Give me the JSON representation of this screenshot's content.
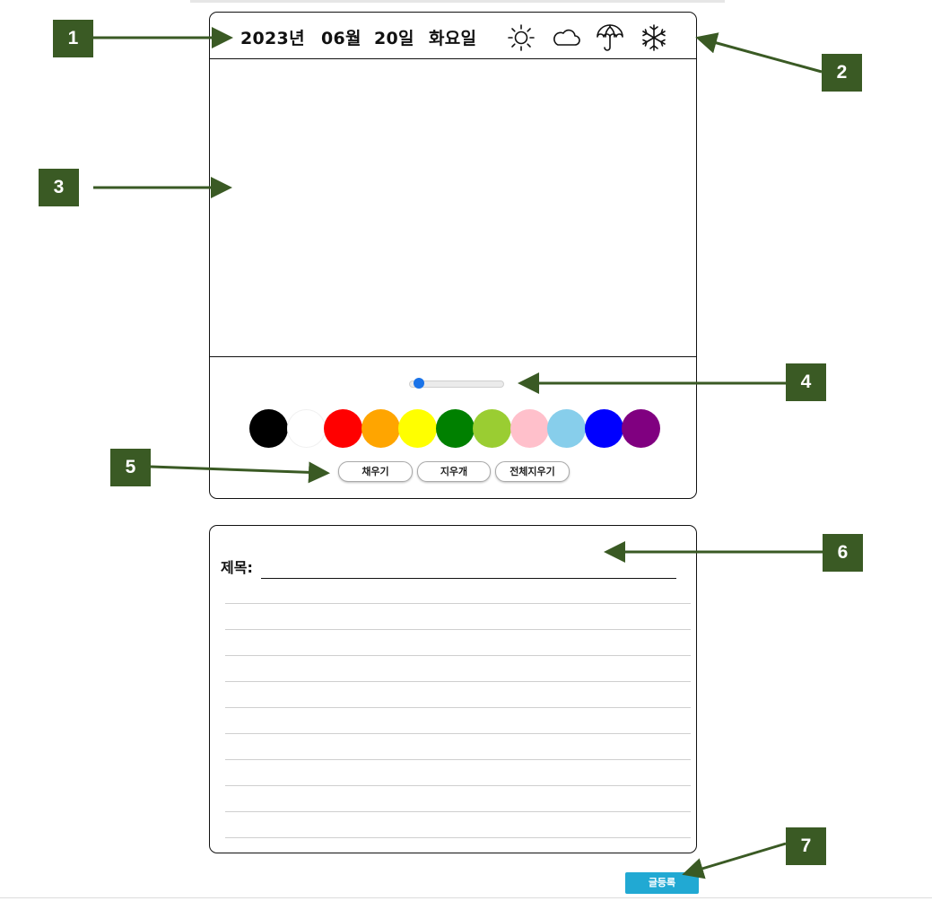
{
  "header": {
    "year": "2023년",
    "month": "06월",
    "day": "20일",
    "weekday": "화요일"
  },
  "weather": [
    {
      "name": "sunny",
      "icon": "sun-icon"
    },
    {
      "name": "cloudy",
      "icon": "cloud-icon"
    },
    {
      "name": "rainy",
      "icon": "umbrella-icon"
    },
    {
      "name": "snowy",
      "icon": "snowflake-icon"
    }
  ],
  "brush_size": {
    "value_fraction": 0.05
  },
  "palette": [
    "#000000",
    "#ffffff",
    "#ff0000",
    "#ffa500",
    "#ffff00",
    "#008000",
    "#9acd32",
    "#ffc0cb",
    "#87ceeb",
    "#0000ff",
    "#800080"
  ],
  "tools": {
    "fill": "채우기",
    "eraser": "지우개",
    "clear_all": "전체지우기"
  },
  "writing": {
    "title_label": "제목:",
    "title_value": "",
    "body_value": ""
  },
  "submit_label": "글등록",
  "callouts": [
    "1",
    "2",
    "3",
    "4",
    "5",
    "6",
    "7"
  ],
  "accent": "#3a5a24",
  "submit_color": "#21a9d3"
}
